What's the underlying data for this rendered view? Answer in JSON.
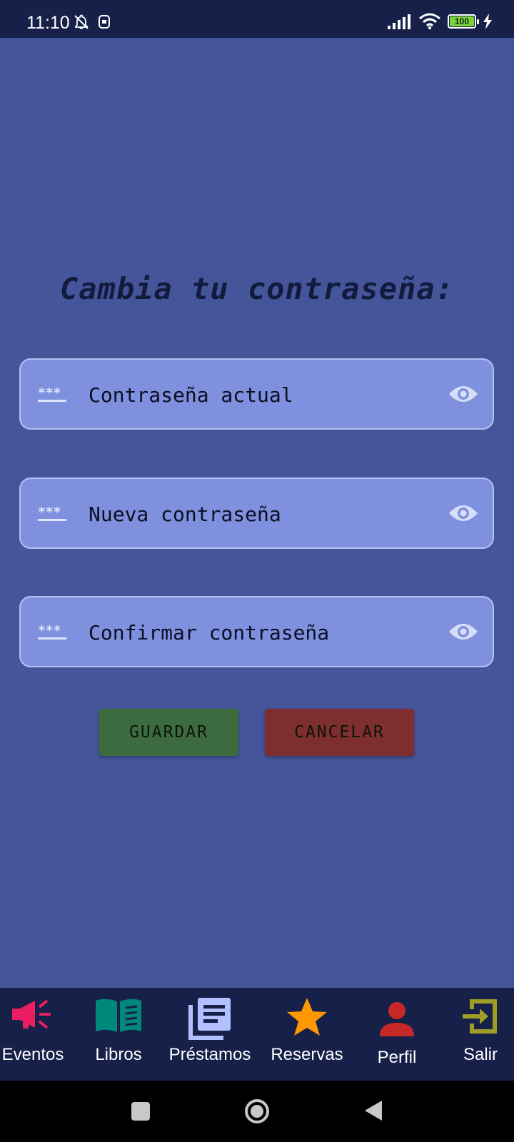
{
  "status_bar": {
    "time": "11:10",
    "battery": "100",
    "battery_level": 1.0,
    "icons": [
      "notifications-off-icon",
      "sim-icon",
      "signal-icon",
      "wifi-icon",
      "battery-icon",
      "charging-icon"
    ]
  },
  "title": "Cambia tu contraseña:",
  "fields": [
    {
      "label": "Contraseña actual",
      "icon": "password-icon",
      "toggle_icon": "eye-icon"
    },
    {
      "label": "Nueva contraseña",
      "icon": "password-icon",
      "toggle_icon": "eye-icon"
    },
    {
      "label": "Confirmar contraseña",
      "icon": "password-icon",
      "toggle_icon": "eye-icon"
    }
  ],
  "buttons": {
    "save": "GUARDAR",
    "cancel": "CANCELAR"
  },
  "nav": {
    "items": [
      {
        "label": "Eventos",
        "icon": "megaphone-icon",
        "color": "#e91e63"
      },
      {
        "label": "Libros",
        "icon": "book-icon",
        "color": "#00897b"
      },
      {
        "label": "Préstamos",
        "icon": "library-books-icon",
        "color": "#b3c0ff"
      },
      {
        "label": "Reservas",
        "icon": "star-icon",
        "color": "#ff9800"
      },
      {
        "label": "Perfil",
        "icon": "person-icon",
        "color": "#c62828"
      },
      {
        "label": "Salir",
        "icon": "exit-icon",
        "color": "#9e9d24"
      }
    ]
  },
  "system_nav": {
    "icons": [
      "recents-icon",
      "home-icon",
      "back-icon"
    ]
  },
  "colors": {
    "background": "#45559a",
    "bars": "#162048",
    "field": "#7f91de",
    "save": "#3b6b3e",
    "cancel": "#7e2e2f"
  }
}
